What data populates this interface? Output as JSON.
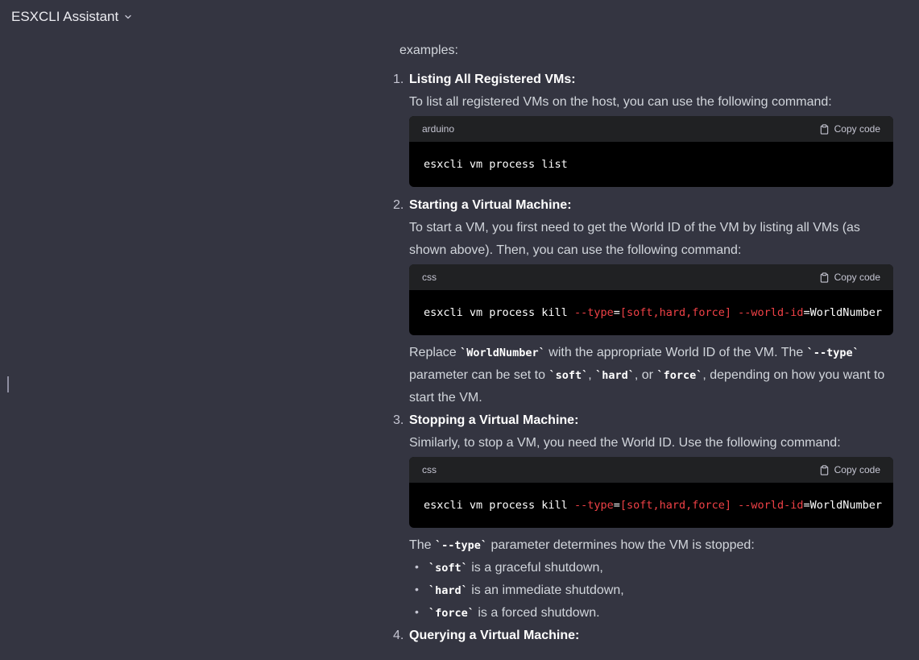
{
  "app": {
    "title": "ESXCLI Assistant"
  },
  "intro": "examples:",
  "items": [
    {
      "num": "1.",
      "title": "Listing All Registered VMs:",
      "desc": "To list all registered VMs on the host, you can use the following command:",
      "code": {
        "lang": "arduino",
        "copy": "Copy code",
        "text": "esxcli vm process list"
      }
    },
    {
      "num": "2.",
      "title": "Starting a Virtual Machine:",
      "desc": "To start a VM, you first need to get the World ID of the VM by listing all VMs (as shown above). Then, you can use the following command:",
      "code": {
        "lang": "css",
        "copy": "Copy code",
        "t1": "esxcli vm process kill ",
        "t2": "--type",
        "t3": "=",
        "t4": "[soft,hard,force]",
        "t5": " ",
        "t6": "--world-id",
        "t7": "=WorldNumber"
      },
      "note": {
        "a": "Replace ",
        "c1": "`WorldNumber`",
        "b": " with the appropriate World ID of the VM. The ",
        "c2": "`--type`",
        "c": " parameter can be set to ",
        "c3": "`soft`",
        "d": ", ",
        "c4": "`hard`",
        "e": ", or ",
        "c5": "`force`",
        "f": ", depending on how you want to start the VM."
      }
    },
    {
      "num": "3.",
      "title": "Stopping a Virtual Machine:",
      "desc": "Similarly, to stop a VM, you need the World ID. Use the following command:",
      "code": {
        "lang": "css",
        "copy": "Copy code",
        "t1": "esxcli vm process kill ",
        "t2": "--type",
        "t3": "=",
        "t4": "[soft,hard,force]",
        "t5": " ",
        "t6": "--world-id",
        "t7": "=WorldNumber"
      },
      "note": {
        "a": "The ",
        "c1": "`--type`",
        "b": " parameter determines how the VM is stopped:"
      },
      "bullets": [
        {
          "code": "`soft`",
          "text": " is a graceful shutdown,"
        },
        {
          "code": "`hard`",
          "text": " is an immediate shutdown,"
        },
        {
          "code": "`force`",
          "text": " is a forced shutdown."
        }
      ]
    },
    {
      "num": "4.",
      "title": "Querying a Virtual Machine:"
    }
  ]
}
